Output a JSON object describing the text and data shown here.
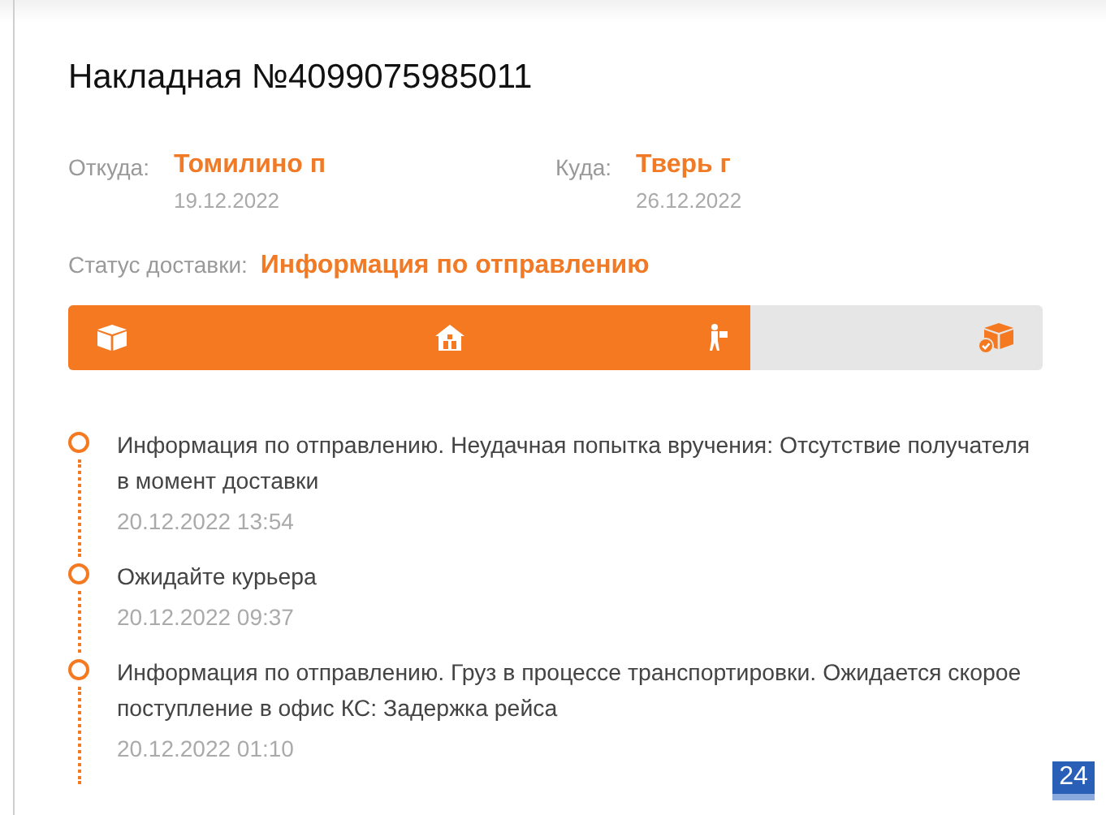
{
  "title": "Накладная №4099075985011",
  "route": [
    {
      "label": "Откуда:",
      "city": "Томилино п",
      "date": "19.12.2022"
    },
    {
      "label": "Куда:",
      "city": "Тверь г",
      "date": "26.12.2022"
    }
  ],
  "status": {
    "label": "Статус доставки:",
    "value": "Информация по отправлению"
  },
  "progress": {
    "level": 0.7,
    "stages": [
      {
        "kind": "box"
      },
      {
        "kind": "warehouse"
      },
      {
        "kind": "courier"
      },
      {
        "kind": "delivered"
      }
    ]
  },
  "events": [
    {
      "text": "Информация по отправлению. Неудачная попытка вручения: Отсутствие получателя в момент доставки",
      "time": "20.12.2022 13:54"
    },
    {
      "text": "Ожидайте курьера",
      "time": "20.12.2022 09:37"
    },
    {
      "text": "Информация по отправлению. Груз в процессе транспортировки. Ожидается скорое поступление в офис КС: Задержка рейса",
      "time": "20.12.2022 01:10"
    }
  ],
  "badge": "24"
}
